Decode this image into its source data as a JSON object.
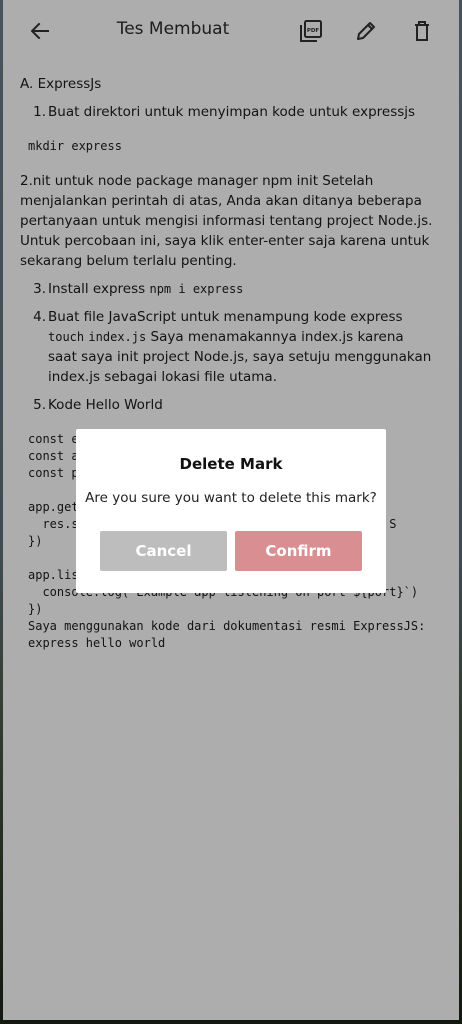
{
  "header": {
    "title": "Tes Membuat",
    "back_icon": "arrow-left-icon",
    "pdf_icon": "pdf-export-icon",
    "edit_icon": "pencil-icon",
    "delete_icon": "trash-icon"
  },
  "note": {
    "section_heading": "A. ExpressJs",
    "item1_num": "1.",
    "item1_text": "Buat direktori untuk menyimpan kode untuk expressjs",
    "code1": "mkdir express",
    "paragraph": "2.nit untuk node package manager npm init Setelah menjalankan perintah di atas, Anda akan ditanya beberapa pertanyaan untuk mengisi informasi tentang project Node.js. Untuk percobaan ini, saya klik enter-enter saja karena untuk sekarang belum terlalu penting.",
    "item3_num": "3.",
    "item3_text": "Install express",
    "item3_code": "npm i express",
    "item4_num": "4.",
    "item4_text_a": "Buat file JavaScript untuk menampung kode express",
    "item4_code_a": "touch",
    "item4_code_b": "index.js",
    "item4_text_b": "Saya menamakannya index.js karena saat saya init project Node.js, saya setuju menggunakan index.js sebagai lokasi file utama.",
    "item5_num": "5.",
    "item5_text": "Kode Hello World",
    "code_block": "const e\nconst a\nconst p\n\napp.get\n  res.s                                    a Adhy S\n})\n\napp.lis\n  console.log(`Example app listening on port ${port}`)\n})\nSaya menggunakan kode dari dokumentasi resmi ExpressJS:\nexpress hello world"
  },
  "dialog": {
    "title": "Delete Mark",
    "message": "Are you sure you want to delete this mark?",
    "cancel_label": "Cancel",
    "confirm_label": "Confirm"
  },
  "colors": {
    "cancel_bg": "#bdbdbd",
    "confirm_bg": "#d98e91",
    "overlay": "rgba(0,0,0,0.32)"
  }
}
